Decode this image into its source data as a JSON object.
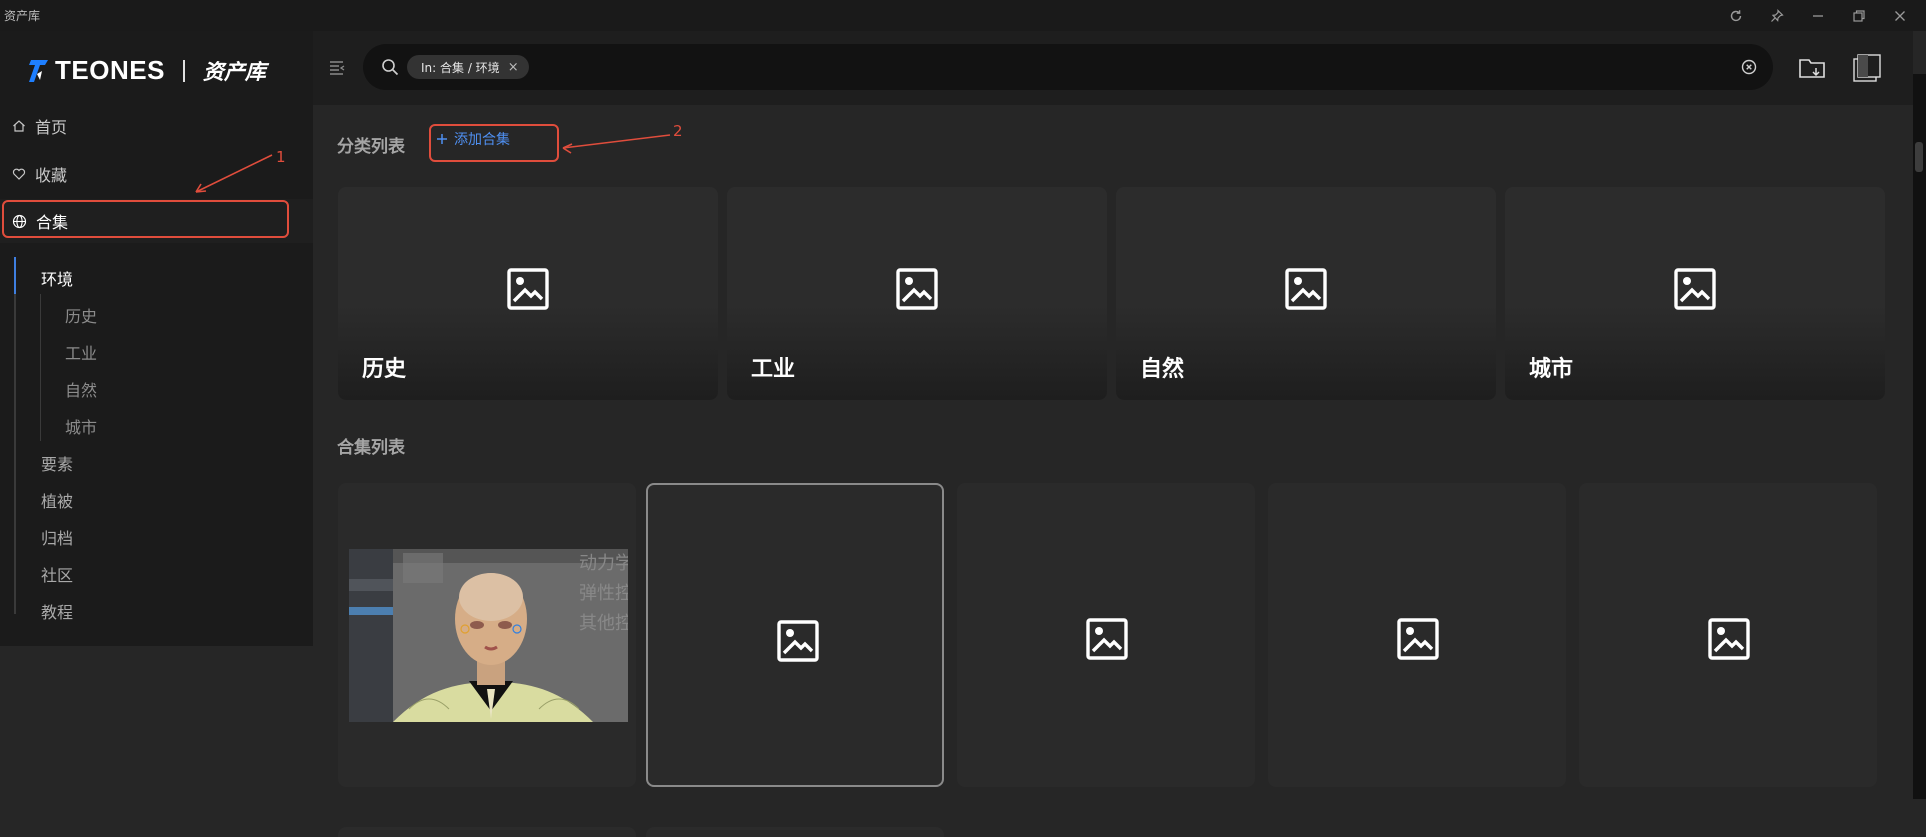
{
  "window": {
    "title": "资产库",
    "controls": [
      "refresh-icon",
      "pin-icon",
      "minimize-icon",
      "restore-icon",
      "close-icon"
    ]
  },
  "sidebar": {
    "logo_text": "TEONES",
    "logo_subtitle": "资产库",
    "nav": [
      {
        "label": "首页",
        "icon": "home-icon"
      },
      {
        "label": "收藏",
        "icon": "heart-icon"
      },
      {
        "label": "合集",
        "icon": "globe-icon",
        "active": true
      }
    ],
    "tree": [
      {
        "label": "环境",
        "current": true
      },
      {
        "label": "历史",
        "child": true
      },
      {
        "label": "工业",
        "child": true
      },
      {
        "label": "自然",
        "child": true
      },
      {
        "label": "城市",
        "child": true
      },
      {
        "label": "要素"
      },
      {
        "label": "植被"
      },
      {
        "label": "归档"
      },
      {
        "label": "社区"
      },
      {
        "label": "教程"
      }
    ]
  },
  "search": {
    "chip": "In: 合集 / 环境",
    "chip_close": "×"
  },
  "categories": {
    "title": "分类列表",
    "add_label": "添加合集",
    "add_icon": "plus-icon",
    "items": [
      "历史",
      "工业",
      "自然",
      "城市"
    ]
  },
  "collections": {
    "title": "合集列表",
    "items": [
      {
        "thumb": "character-render-thumbnail"
      },
      {
        "selected": true
      },
      {},
      {},
      {}
    ]
  },
  "annotations": {
    "accent_color": "#e04d3c",
    "labels": [
      "1",
      "2"
    ]
  },
  "colors": {
    "accent_blue": "#4f8ff0",
    "annotation_red": "#e04d3c",
    "background": "#262626",
    "sidebar": "#1b1b1b"
  }
}
